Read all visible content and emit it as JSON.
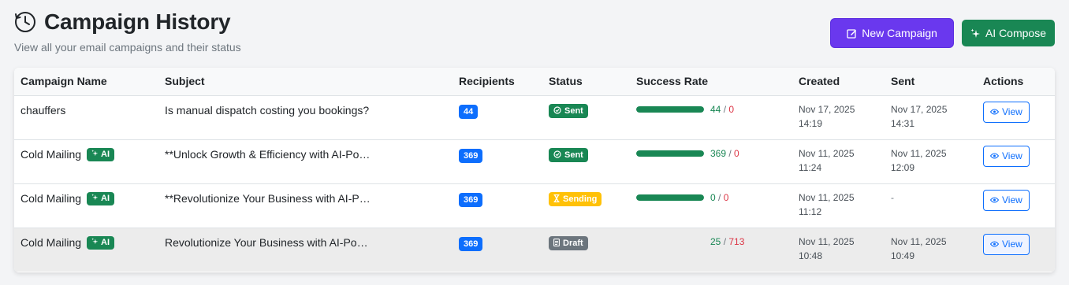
{
  "header": {
    "title": "Campaign History",
    "subtitle": "View all your email campaigns and their status",
    "icon": "clock-icon"
  },
  "actions": {
    "new_campaign": "New Campaign",
    "ai_compose": "AI Compose"
  },
  "colors": {
    "primary": "#6a38ee",
    "success": "#198754",
    "info": "#0d6efd",
    "warning": "#ffc107",
    "danger": "#dc3545",
    "secondary": "#6c757d"
  },
  "table": {
    "columns": [
      "Campaign Name",
      "Subject",
      "Recipients",
      "Status",
      "Success Rate",
      "Created",
      "Sent",
      "Actions"
    ],
    "rows": [
      {
        "name": "chauffers",
        "ai": "",
        "subject": "Is manual dispatch costing you bookings?",
        "recipients": "44",
        "status": "Sent",
        "success": "44",
        "failed": "0",
        "progress": 1.0,
        "created_date": "Nov 17, 2025",
        "created_time": "14:19",
        "sent_date": "Nov 17, 2025",
        "sent_time": "14:31",
        "action": "View"
      },
      {
        "name": "Cold Mailing",
        "ai": "AI",
        "subject": "**Unlock Growth & Efficiency with AI-Po…",
        "recipients": "369",
        "status": "Sent",
        "success": "369",
        "failed": "0",
        "progress": 1.0,
        "created_date": "Nov 11, 2025",
        "created_time": "11:24",
        "sent_date": "Nov 11, 2025",
        "sent_time": "12:09",
        "action": "View"
      },
      {
        "name": "Cold Mailing",
        "ai": "AI",
        "subject": "**Revolutionize Your Business with AI-P…",
        "recipients": "369",
        "status": "Sending",
        "success": "0",
        "failed": "0",
        "progress": 1.0,
        "created_date": "Nov 11, 2025",
        "created_time": "11:12",
        "sent_date": "-",
        "sent_time": "",
        "action": "View"
      },
      {
        "name": "Cold Mailing",
        "ai": "AI",
        "subject": "Revolutionize Your Business with AI-Po…",
        "recipients": "369",
        "status": "Draft",
        "success": "25",
        "failed": "713",
        "progress": 0,
        "created_date": "Nov 11, 2025",
        "created_time": "10:48",
        "sent_date": "Nov 11, 2025",
        "sent_time": "10:49",
        "action": "View"
      }
    ]
  }
}
